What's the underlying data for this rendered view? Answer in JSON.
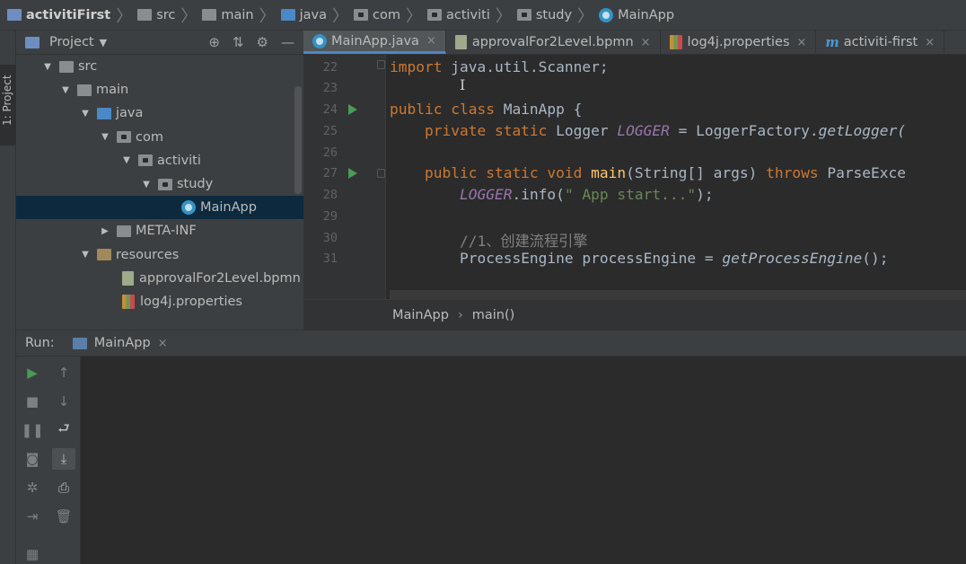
{
  "navbar": {
    "crumbs": [
      "activitiFirst",
      "src",
      "main",
      "java",
      "com",
      "activiti",
      "study",
      "MainApp"
    ]
  },
  "left_strip": {
    "project_tab": "1: Project"
  },
  "project_panel": {
    "title": "Project",
    "tree": [
      {
        "label": "src",
        "depth": 1,
        "expanded": true,
        "icon": "folder-icon"
      },
      {
        "label": "main",
        "depth": 2,
        "expanded": true,
        "icon": "folder-icon"
      },
      {
        "label": "java",
        "depth": 3,
        "expanded": true,
        "icon": "source-folder-icon"
      },
      {
        "label": "com",
        "depth": 4,
        "expanded": true,
        "icon": "package-icon"
      },
      {
        "label": "activiti",
        "depth": 5,
        "expanded": true,
        "icon": "package-icon"
      },
      {
        "label": "study",
        "depth": 6,
        "expanded": true,
        "icon": "package-icon"
      },
      {
        "label": "MainApp",
        "depth": 7,
        "selected": true,
        "icon": "class-icon"
      },
      {
        "label": "META-INF",
        "depth": 4,
        "expanded": false,
        "icon": "folder-icon"
      },
      {
        "label": "resources",
        "depth": 3,
        "expanded": true,
        "icon": "resources-folder-icon"
      },
      {
        "label": "approvalFor2Level.bpmn",
        "depth": 5,
        "icon": "file-icon"
      },
      {
        "label": "log4j.properties",
        "depth": 5,
        "icon": "properties-file-icon"
      }
    ]
  },
  "tabs": [
    {
      "label": "MainApp.java",
      "active": true,
      "icon": "class-icon"
    },
    {
      "label": "approvalFor2Level.bpmn",
      "active": false,
      "icon": "file-icon"
    },
    {
      "label": "log4j.properties",
      "active": false,
      "icon": "properties-file-icon"
    },
    {
      "label": "activiti-first",
      "active": false,
      "icon": "maven-icon"
    }
  ],
  "editor": {
    "line_numbers": [
      "22",
      "23",
      "24",
      "25",
      "26",
      "27",
      "28",
      "29",
      "30",
      "31"
    ],
    "lines": {
      "l22_kw": "import",
      "l22_rest": " java.util.Scanner;",
      "l24_kw": "public class",
      "l24_rest": " MainApp {",
      "l25_kw": "private static",
      "l25_type": " Logger ",
      "l25_field": "LOGGER",
      "l25_eq": " = LoggerFactory.",
      "l25_call": "getLogger(",
      "l27_kw": "public static void",
      "l27_fn": " main",
      "l27_args": "(String[] args) ",
      "l27_throws": "throws",
      "l27_exc": " ParseExce",
      "l28_field": "LOGGER",
      "l28_call": ".info(",
      "l28_str": "\" App start...\"",
      "l28_end": ");",
      "l30_comment": "//1、创建流程引擎",
      "l31_type": "ProcessEngine processEngine = ",
      "l31_call": "getProcessEngine",
      "l31_end": "();"
    }
  },
  "editor_breadcrumb": {
    "items": [
      "MainApp",
      "main()"
    ]
  },
  "run_panel": {
    "label": "Run:",
    "tab_label": "MainApp"
  }
}
